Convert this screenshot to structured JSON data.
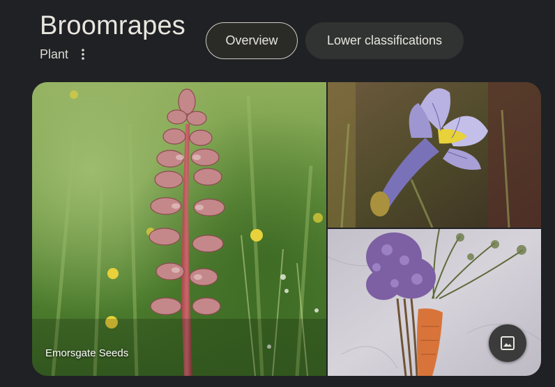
{
  "entity": {
    "title": "Broomrapes",
    "subtitle": "Plant"
  },
  "tabs": [
    {
      "label": "Overview",
      "selected": true
    },
    {
      "label": "Lower classifications",
      "selected": false
    }
  ],
  "gallery": {
    "main_image_caption": "Emorsgate Seeds",
    "images": [
      {
        "name": "broomrape-flower-spike"
      },
      {
        "name": "purple-broomrape-flower"
      },
      {
        "name": "broomrape-on-carrot"
      }
    ],
    "more_images_icon": "image-icon"
  },
  "colors": {
    "background": "#202124",
    "text": "#e8e6df",
    "chip_selected_border": "#cfcdc6",
    "chip_unselected_bg": "#303331"
  }
}
